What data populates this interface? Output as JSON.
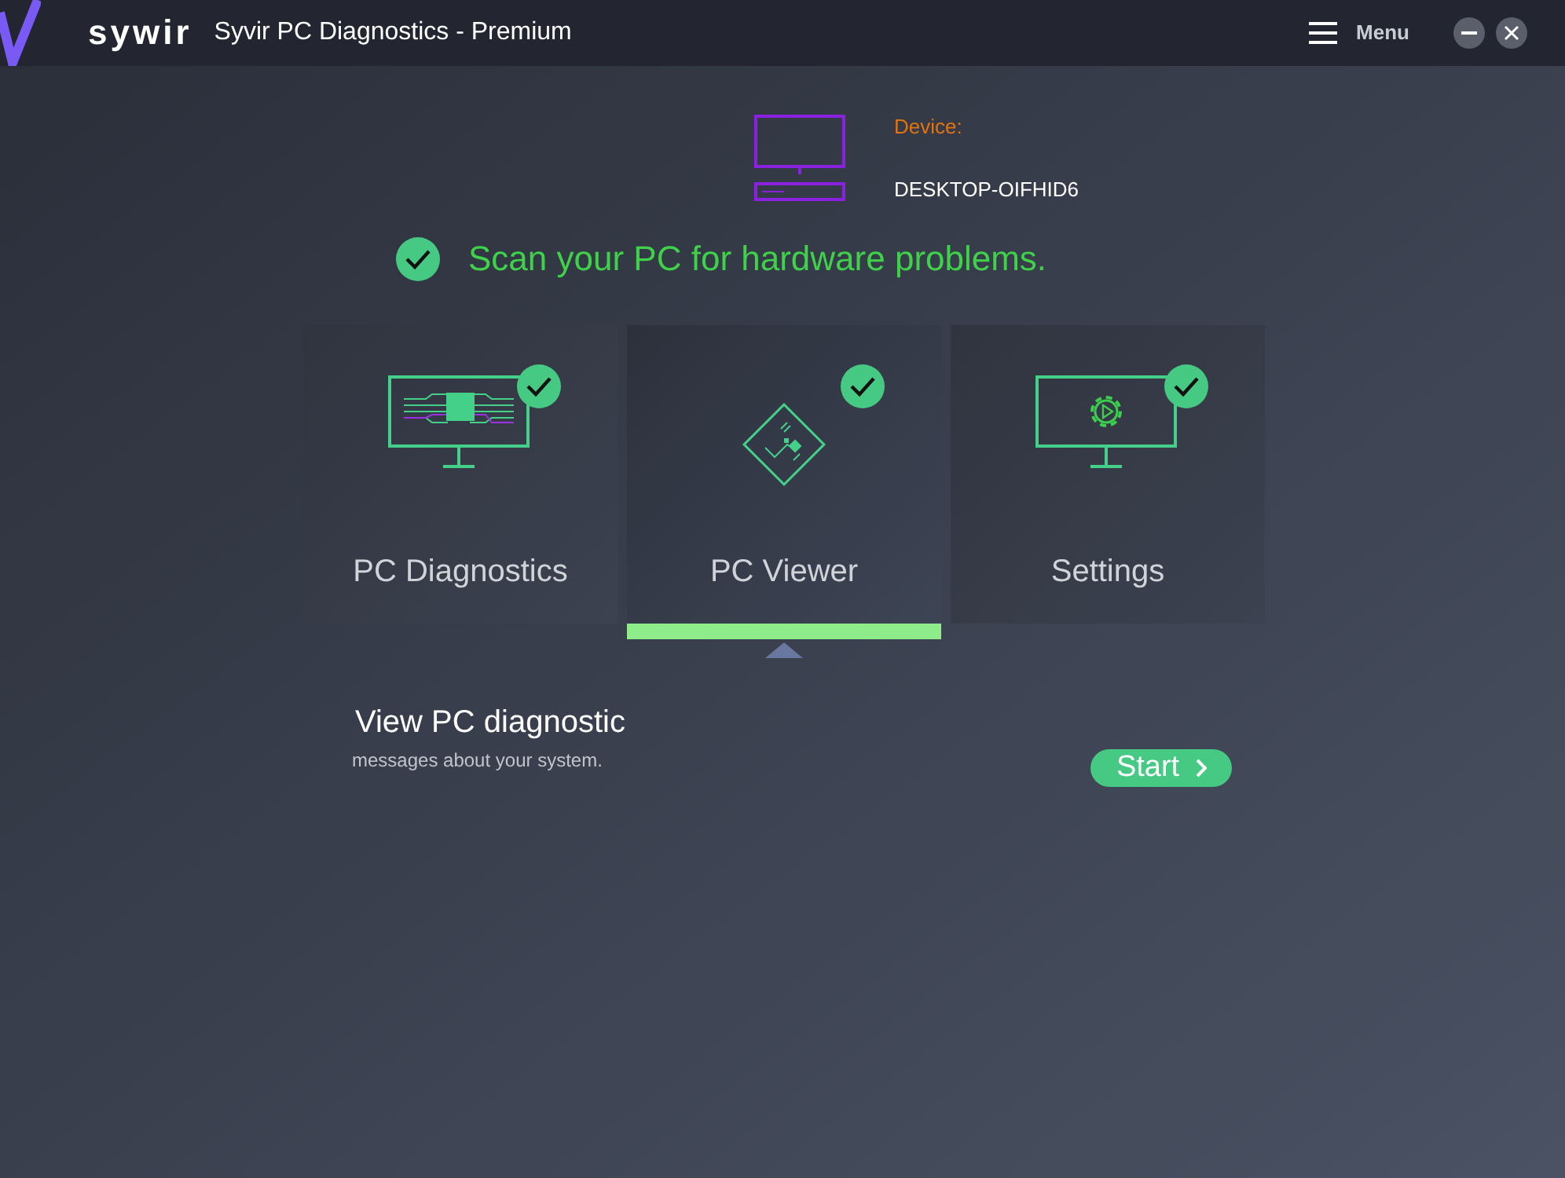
{
  "window": {
    "logo": "sywir",
    "title": "Syvir PC Diagnostics - Premium",
    "menu": "Menu"
  },
  "device": {
    "label": "Device:",
    "name": "DESKTOP-OIFHID6"
  },
  "status": {
    "checked": true,
    "text": "Scan your PC for hardware problems."
  },
  "tiles": [
    {
      "kind": "diagnostics",
      "label": "PC Diagnostics",
      "checked": true,
      "selected": false
    },
    {
      "kind": "viewer",
      "label": "PC Viewer",
      "checked": true,
      "selected": true
    },
    {
      "kind": "settings",
      "label": "Settings",
      "checked": true,
      "selected": false
    }
  ],
  "detail": {
    "title": "View PC diagnostic",
    "text": "messages about your system.",
    "button": "Start"
  }
}
